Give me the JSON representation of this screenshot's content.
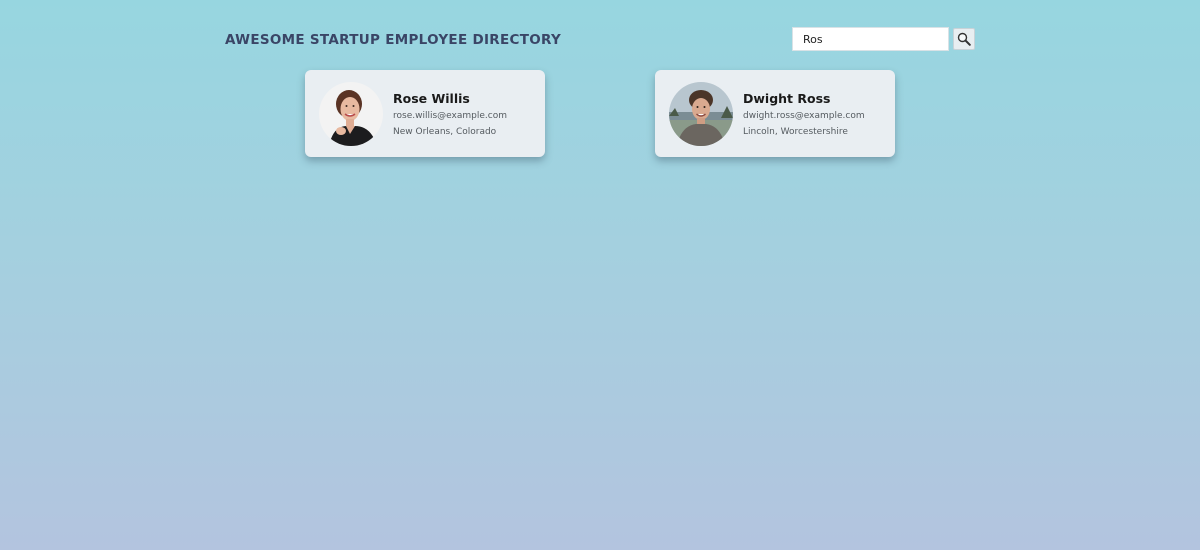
{
  "header": {
    "title": "AWESOME STARTUP EMPLOYEE DIRECTORY"
  },
  "search": {
    "value": "Ros",
    "button_icon": "search-icon"
  },
  "employees": [
    {
      "name": "Rose Willis",
      "email": "rose.willis@example.com",
      "location": "New Orleans, Colorado",
      "avatar_icon": "avatar-photo"
    },
    {
      "name": "Dwight Ross",
      "email": "dwight.ross@example.com",
      "location": "Lincoln, Worcestershire",
      "avatar_icon": "avatar-photo"
    }
  ]
}
